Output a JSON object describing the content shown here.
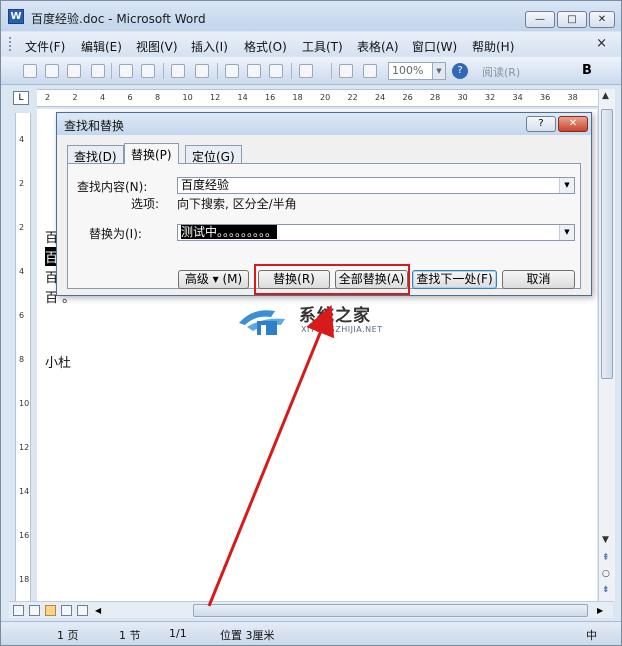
{
  "window": {
    "title": "百度经验.doc - Microsoft Word",
    "minimize": "—",
    "maximize": "□",
    "close": "✕",
    "icon_letter": "W"
  },
  "menu": {
    "items": [
      "文件(F)",
      "编辑(E)",
      "视图(V)",
      "插入(I)",
      "格式(O)",
      "工具(T)",
      "表格(A)",
      "窗口(W)",
      "帮助(H)"
    ],
    "close": "×"
  },
  "toolbar": {
    "zoom": "100%",
    "read": "阅读(R)",
    "bold": "B",
    "help": "?"
  },
  "ruler": {
    "corner": "L",
    "h_ticks": [
      "2",
      "2",
      "4",
      "6",
      "8",
      "10",
      "12",
      "14",
      "16",
      "18",
      "20",
      "22",
      "24",
      "26",
      "28",
      "30",
      "32",
      "34",
      "36",
      "38"
    ],
    "v_ticks": [
      "4",
      "2",
      "2",
      "4",
      "6",
      "8",
      "10",
      "12",
      "14",
      "16",
      "18"
    ]
  },
  "document": {
    "lines": [
      "百",
      "百",
      "百",
      "百     。",
      "小杜"
    ]
  },
  "dialog": {
    "title": "查找和替换",
    "help": "?",
    "close": "✕",
    "tabs": [
      "查找(D)",
      "替换(P)",
      "定位(G)"
    ],
    "find_label": "查找内容(N):",
    "find_value": "百度经验",
    "options_label": "选项:",
    "options_value": "向下搜索, 区分全/半角",
    "replace_label": "替换为(I):",
    "replace_value": "测试中。。。。。。。。。",
    "buttons": {
      "more": "高级 ▾ (M)",
      "replace": "替换(R)",
      "replace_all": "全部替换(A)",
      "find_next": "查找下一处(F)",
      "cancel": "取消"
    }
  },
  "watermark": {
    "cn": "系统之家",
    "en": "XITONGZHIJIA.NET"
  },
  "status": {
    "page": "1 页",
    "section": "1 节",
    "pages": "1/1",
    "position": "位置 3厘米",
    "lang": "中"
  },
  "colors": {
    "highlight": "#d71a1a",
    "arrow": "#d71a1a"
  }
}
